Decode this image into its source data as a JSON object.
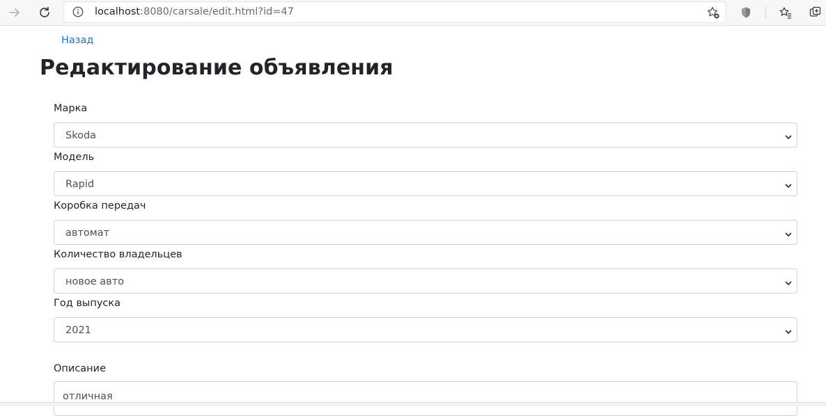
{
  "browser": {
    "url_host": "localhost",
    "url_path": ":8080/carsale/edit.html?id=47",
    "icons": [
      "forward-icon",
      "reload-icon",
      "info-icon",
      "favorite-add-icon",
      "shield-icon",
      "favorites-icon",
      "collections-icon"
    ]
  },
  "page": {
    "back_link": "Назад",
    "title": "Редактирование объявления"
  },
  "form": {
    "brand": {
      "label": "Марка",
      "value": "Skoda"
    },
    "model": {
      "label": "Модель",
      "value": "Rapid"
    },
    "gearbox": {
      "label": "Коробка передач",
      "value": "автомат"
    },
    "owners": {
      "label": "Количество владельцев",
      "value": "новое авто"
    },
    "year": {
      "label": "Год выпуска",
      "value": "2021"
    },
    "description": {
      "label": "Описание",
      "value": "отличная"
    }
  },
  "colors": {
    "link": "#1a73e8",
    "text": "#212529",
    "field_border": "#ced4da"
  }
}
